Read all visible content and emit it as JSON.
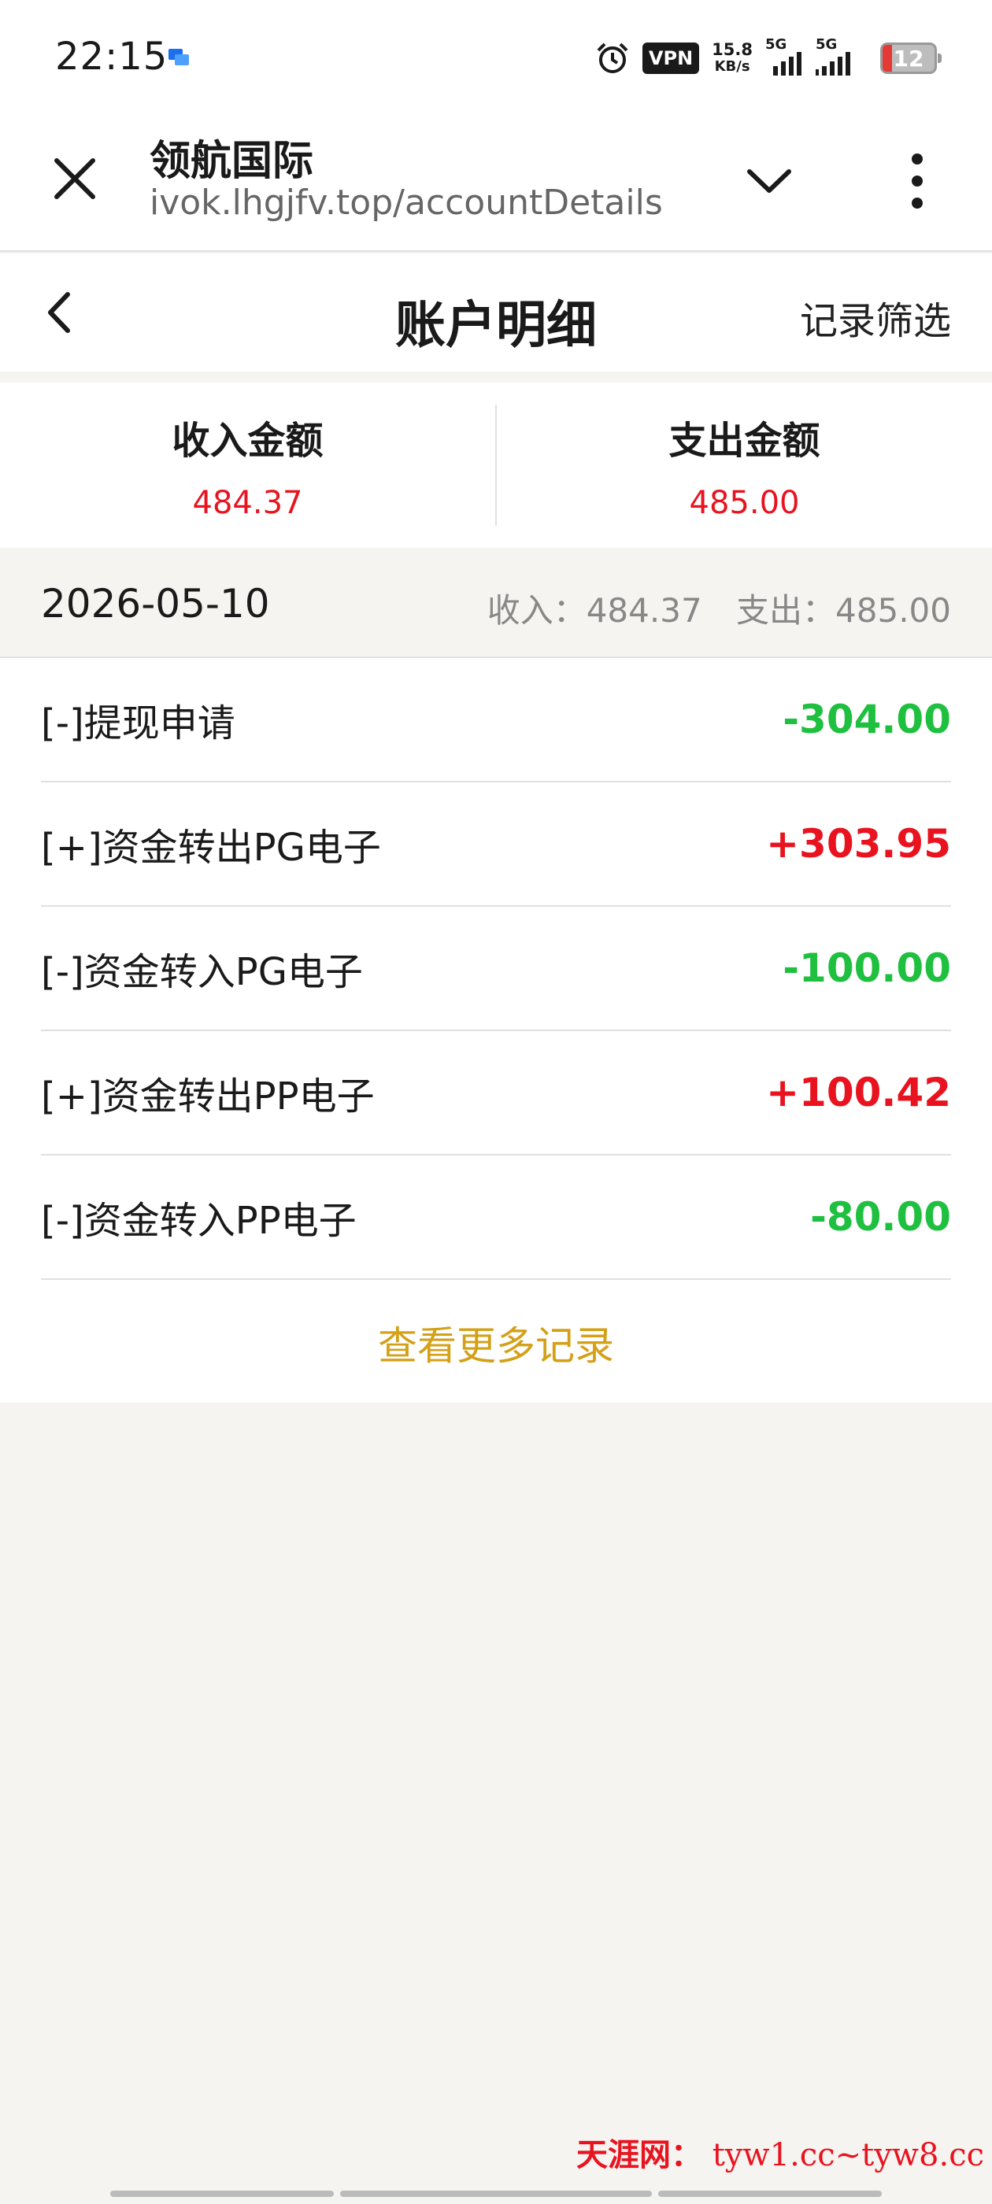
{
  "status_bar": {
    "time": "22:15",
    "vpn": "VPN",
    "net_speed": "15.8",
    "net_unit": "KB/s",
    "sim1": "5G",
    "sim2": "5G",
    "battery": "12"
  },
  "browser": {
    "title": "领航国际",
    "url": "ivok.lhgjfv.top/accountDetails"
  },
  "header": {
    "title": "账户明细",
    "filter": "记录筛选"
  },
  "summary": {
    "income_label": "收入金额",
    "income_value": "484.37",
    "expense_label": "支出金额",
    "expense_value": "485.00"
  },
  "date_group": {
    "date": "2026-05-10",
    "income": "收入：484.37",
    "expense": "支出：485.00"
  },
  "records": [
    {
      "label": "[-]提现申请",
      "amount": "-304.00",
      "sign": "neg"
    },
    {
      "label": "[+]资金转出PG电子",
      "amount": "+303.95",
      "sign": "pos"
    },
    {
      "label": "[-]资金转入PG电子",
      "amount": "-100.00",
      "sign": "neg"
    },
    {
      "label": "[+]资金转出PP电子",
      "amount": "+100.42",
      "sign": "pos"
    },
    {
      "label": "[-]资金转入PP电子",
      "amount": "-80.00",
      "sign": "neg"
    }
  ],
  "more": "查看更多记录",
  "watermark": {
    "brand": "天涯网：",
    "url": "tyw1.cc~tyw8.cc"
  },
  "colors": {
    "income_red": "#e8131f",
    "expense_green": "#1fbf3f",
    "link_gold": "#d4a017"
  }
}
